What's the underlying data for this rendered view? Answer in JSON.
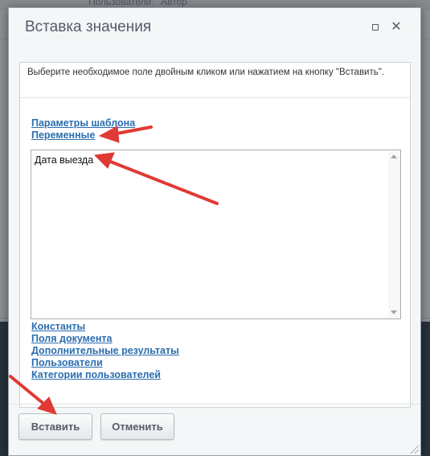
{
  "background": {
    "header_left": "Пользователи",
    "header_right": "Автор"
  },
  "dialog": {
    "title": "Вставка значения",
    "hint": "Выберите необходимое поле двойным кликом или нажатием на кнопку \"Вставить\".",
    "groups": {
      "template_params": "Параметры шаблона",
      "variables": "Переменные",
      "constants": "Константы",
      "document_fields": "Поля документа",
      "additional_results": "Дополнительные результаты",
      "users": "Пользователи",
      "user_categories": "Категории пользователей"
    },
    "list": {
      "items": [
        "Дата выезда"
      ]
    },
    "buttons": {
      "insert": "Вставить",
      "cancel": "Отменить"
    }
  },
  "colors": {
    "link": "#2a6db0",
    "annotation_arrow": "#e03a34",
    "title_text": "#535c69"
  },
  "icons": {
    "minimize": "minimize-icon",
    "close": "close-icon",
    "resize": "resize-grip-icon"
  }
}
